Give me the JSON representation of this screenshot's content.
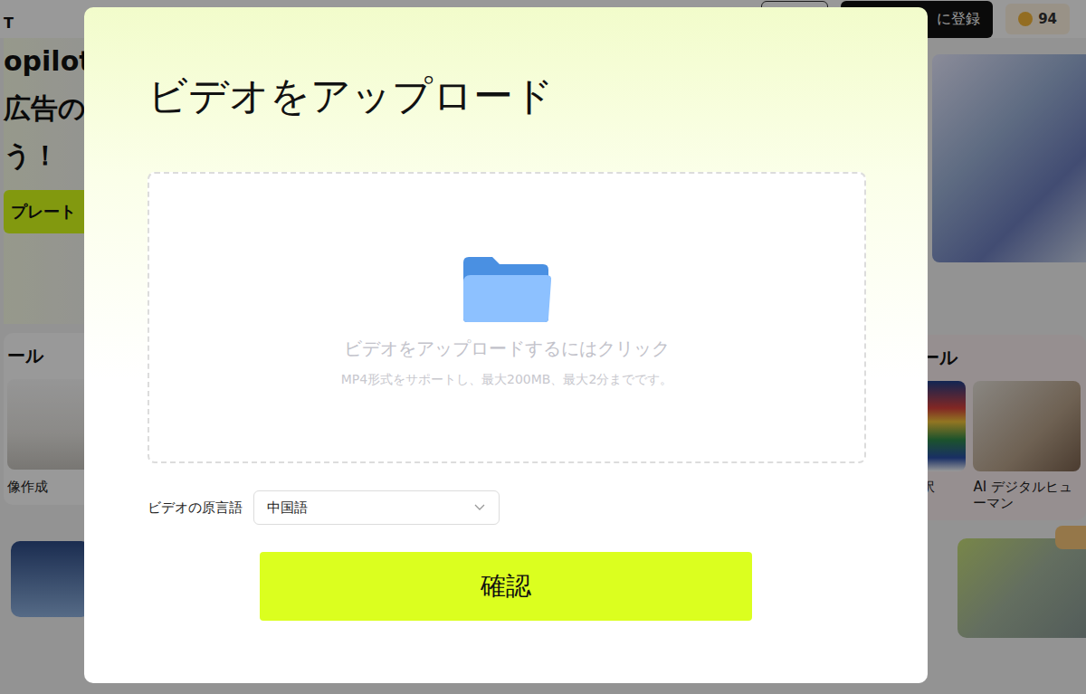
{
  "page": {
    "brand": "T",
    "hero_lines": [
      "opilotC",
      "広告のC",
      "う！"
    ],
    "hero_button": "プレート",
    "header": {
      "register_button": "に登録",
      "coins": "94"
    },
    "left_section": {
      "title": "ール",
      "card_label": "像作成"
    },
    "right_section": {
      "title": "ール",
      "cards": [
        {
          "label": "訳"
        },
        {
          "label": "AI デジタルヒューマン"
        }
      ]
    }
  },
  "dialog": {
    "title": "ビデオをアップロード",
    "dropzone": {
      "prompt": "ビデオをアップロードするにはクリック",
      "hint": "MP4形式をサポートし、最大200MB、最大2分までです。"
    },
    "language": {
      "label": "ビデオの原言語",
      "value": "中国語"
    },
    "confirm": "確認"
  }
}
